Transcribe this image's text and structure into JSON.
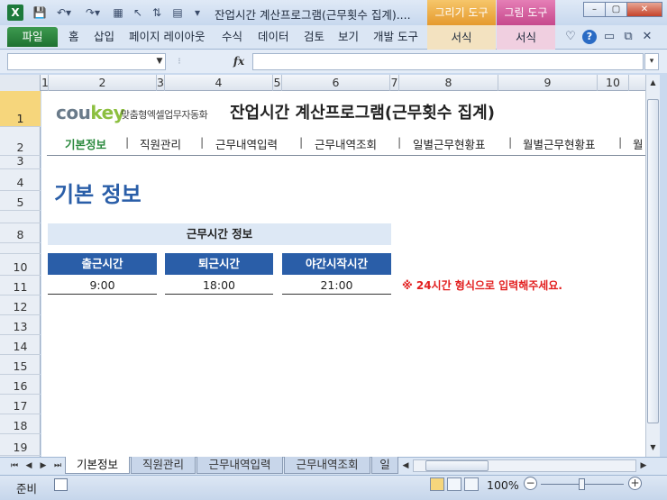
{
  "window": {
    "title": "잔업시간 계산프로그램(근무횟수 집계)....",
    "contextual_tabs": [
      "그리기 도구",
      "그림 도구"
    ],
    "buttons": {
      "minimize": "–",
      "restore": "▢",
      "close": "✕"
    }
  },
  "ribbon": {
    "file_tab": "파일",
    "tabs": [
      "홈",
      "삽입",
      "페이지 레이아웃",
      "수식",
      "데이터",
      "검토",
      "보기",
      "개발 도구"
    ],
    "contextual_subtabs": [
      "서식",
      "서식"
    ]
  },
  "formula_bar": {
    "fx": "fx",
    "name_box": "",
    "formula": ""
  },
  "grid": {
    "columns": [
      "1",
      "2",
      "3",
      "4",
      "5",
      "6",
      "7",
      "8",
      "9",
      "10"
    ],
    "rows": [
      "1",
      "2",
      "3",
      "4",
      "5",
      "",
      "8",
      "",
      "10",
      "11",
      "12",
      "13",
      "14",
      "15",
      "16",
      "17",
      "18",
      "19"
    ]
  },
  "content": {
    "logo": {
      "prefix": "cou",
      "accent": "key",
      "tagline": "맞춤형엑셀업무자동화"
    },
    "app_title": "잔업시간 계산프로그램(근무횟수 집계)",
    "nav": [
      "기본정보",
      "직원관리",
      "근무내역입력",
      "근무내역조회",
      "일별근무현황표",
      "월별근무현황표",
      "월"
    ],
    "nav_separator": "|",
    "page_heading": "기본 정보",
    "section_header": "근무시간 정보",
    "table": {
      "headers": [
        "출근시간",
        "퇴근시간",
        "야간시작시간"
      ],
      "values": [
        "9:00",
        "18:00",
        "21:00"
      ]
    },
    "note": "※ 24시간 형식으로 입력해주세요.",
    "accent_color": "#2a5ea8",
    "active_nav_color": "#2c8a3f",
    "note_color": "#e21e1e"
  },
  "sheet_tabs": [
    "기본정보",
    "직원관리",
    "근무내역입력",
    "근무내역조회",
    "일"
  ],
  "status_bar": {
    "status": "준비",
    "zoom": "100%"
  }
}
